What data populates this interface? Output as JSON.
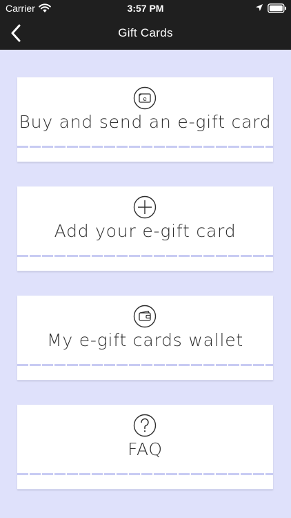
{
  "status_bar": {
    "carrier": "Carrier",
    "time": "3:57 PM"
  },
  "navbar": {
    "title": "Gift Cards"
  },
  "cards": [
    {
      "label": "Buy and send an e-gift card",
      "icon": "e-card-icon"
    },
    {
      "label": "Add your e-gift card",
      "icon": "plus-circle-icon"
    },
    {
      "label": "My e-gift cards wallet",
      "icon": "wallet-icon"
    },
    {
      "label": "FAQ",
      "icon": "question-circle-icon"
    }
  ],
  "colors": {
    "background": "#dfe1fb",
    "topbar": "#1f1f1f",
    "card": "#ffffff",
    "divider": "#c8cbf3"
  }
}
